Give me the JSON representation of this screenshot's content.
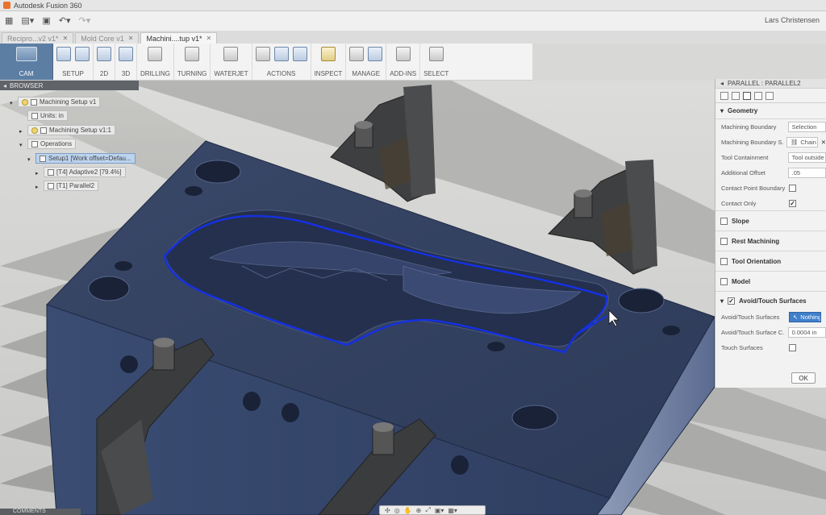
{
  "window": {
    "title": "Autodesk Fusion 360",
    "user": "Lars Christensen"
  },
  "tabs": [
    {
      "label": "Recipro...v2 v1*",
      "active": false
    },
    {
      "label": "Mold Core v1",
      "active": false
    },
    {
      "label": "Machini....tup v1*",
      "active": true
    }
  ],
  "ribbon": {
    "workspace": "CAM",
    "groups": [
      {
        "label": "SETUP"
      },
      {
        "label": "2D"
      },
      {
        "label": "3D"
      },
      {
        "label": "DRILLING"
      },
      {
        "label": "TURNING"
      },
      {
        "label": "WATERJET"
      },
      {
        "label": "ACTIONS"
      },
      {
        "label": "INSPECT"
      },
      {
        "label": "MANAGE"
      },
      {
        "label": "ADD-INS"
      },
      {
        "label": "SELECT"
      }
    ]
  },
  "browser": {
    "title": "BROWSER",
    "nodes": [
      {
        "label": "Machining Setup v1"
      },
      {
        "label": "Units: in"
      },
      {
        "label": "Machining Setup v1:1"
      },
      {
        "label": "Operations"
      },
      {
        "label": "Setup1 [Work offset=Defau..."
      },
      {
        "label": "[T4] Adaptive2 [79.4%]"
      },
      {
        "label": "[T1] Parallel2"
      }
    ]
  },
  "panel": {
    "title": "PARALLEL : PARALLEL2",
    "geometry_section": "Geometry",
    "rows": [
      {
        "label": "Machining Boundary",
        "value": "Selection"
      },
      {
        "label": "Machining Boundary S.",
        "value": "Chain"
      },
      {
        "label": "Tool Containment",
        "value": "Tool outside bo"
      },
      {
        "label": "Additional Offset",
        "value": ".05"
      },
      {
        "label": "Contact Point Boundary",
        "checked": false
      },
      {
        "label": "Contact Only",
        "checked": true
      }
    ],
    "sections": [
      {
        "label": "Slope",
        "checked": false
      },
      {
        "label": "Rest Machining",
        "checked": false
      },
      {
        "label": "Tool Orientation",
        "checked": false
      },
      {
        "label": "Model",
        "checked": false
      },
      {
        "label": "Avoid/Touch Surfaces",
        "checked": true
      }
    ],
    "avoid_rows": [
      {
        "label": "Avoid/Touch Surfaces",
        "value": "Nothing"
      },
      {
        "label": "Avoid/Touch Surface C.",
        "value": "0.0004 in"
      },
      {
        "label": "Touch Surfaces",
        "checked": false
      }
    ],
    "ok_label": "OK"
  },
  "footer": {
    "comments_label": "COMMENTS"
  },
  "colors": {
    "accent": "#3f7fcb",
    "part": "#2f3c5c",
    "toolpath": "#1530e0"
  }
}
